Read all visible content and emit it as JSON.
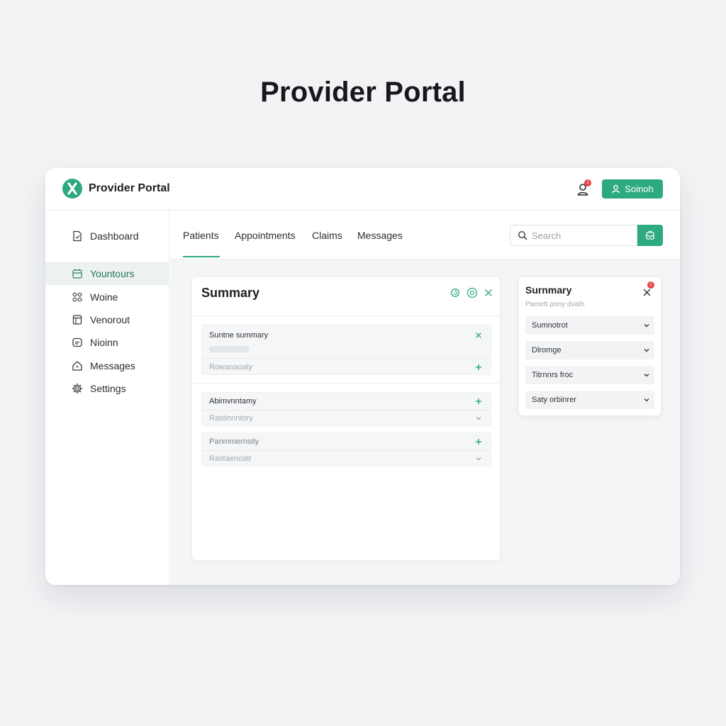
{
  "page": {
    "heading": "Provider Portal"
  },
  "app": {
    "title": "Provider Portal",
    "notification_count": "1",
    "signin_label": "Soinoh"
  },
  "sidebar": {
    "items": [
      {
        "label": "Dashboard",
        "icon": "file-icon"
      },
      {
        "label": "Yountours",
        "icon": "calendar-icon",
        "active": true
      },
      {
        "label": "Woine",
        "icon": "grid-icon"
      },
      {
        "label": "Venorout",
        "icon": "form-icon"
      },
      {
        "label": "Nioinn",
        "icon": "chat-icon"
      },
      {
        "label": "Messages",
        "icon": "home-icon"
      },
      {
        "label": "Settings",
        "icon": "gear-icon"
      }
    ]
  },
  "tabs": [
    {
      "label": "Patients",
      "active": true
    },
    {
      "label": "Appointments"
    },
    {
      "label": "Claims"
    },
    {
      "label": "Messages"
    }
  ],
  "search": {
    "placeholder": "Search"
  },
  "summary_card": {
    "title": "Summary",
    "block1": {
      "title": "Suntne summary",
      "footer": "Rowanaoaty"
    },
    "block2": {
      "title": "Abimvnntamy",
      "sub": "Rastinnntory"
    },
    "block3": {
      "title": "Panmmernsity",
      "sub": "Rastaenoatr"
    }
  },
  "side_panel": {
    "title": "Surnmary",
    "subtitle": "Pamett pony dvath",
    "badge": "1",
    "items": [
      "Sumnotrot",
      "Dlromge",
      "Titrnnrs froc",
      "Saty orbinrer"
    ]
  },
  "colors": {
    "accent": "#2eaa7f",
    "alert": "#e64545"
  }
}
